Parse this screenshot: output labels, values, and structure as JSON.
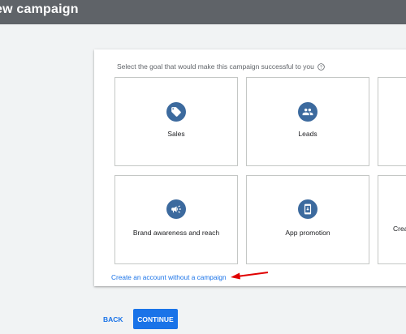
{
  "header": {
    "title": "ew campaign"
  },
  "goal_prompt": "Select the goal that would make this campaign successful to you",
  "goals": [
    {
      "label": "Sales",
      "icon": "tag-icon"
    },
    {
      "label": "Leads",
      "icon": "people-icon"
    },
    {
      "label": "",
      "icon": ""
    },
    {
      "label": "Brand awareness and reach",
      "icon": "megaphone-icon"
    },
    {
      "label": "App promotion",
      "icon": "mobile-app-icon"
    },
    {
      "label": "Crea",
      "icon": ""
    }
  ],
  "no_campaign_link": "Create an account without a campaign",
  "footer": {
    "back_label": "BACK",
    "continue_label": "CONTINUE"
  },
  "colors": {
    "accent": "#1a73e8",
    "icon_circle": "#3c6a9e",
    "header_bg": "#5f6368",
    "annotation_arrow": "#e00000"
  }
}
